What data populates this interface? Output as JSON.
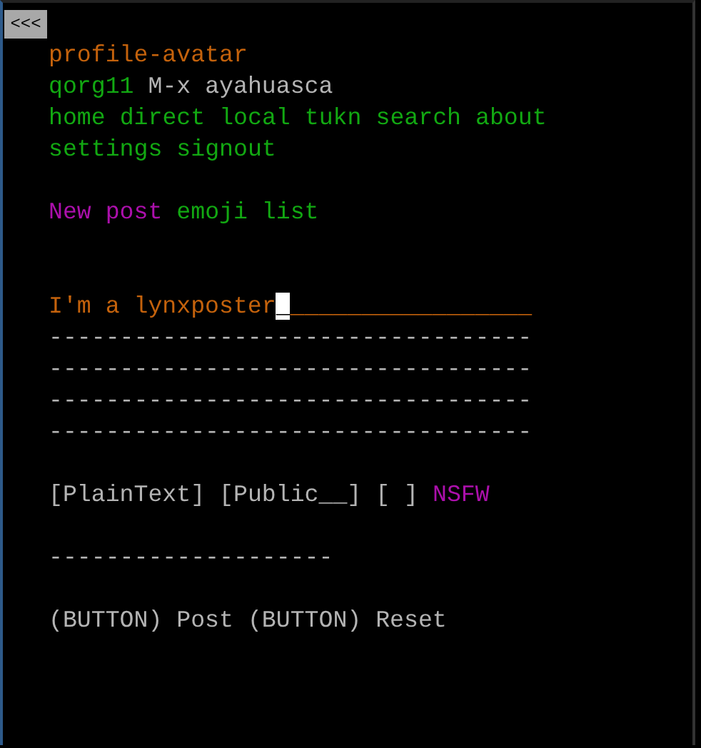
{
  "back_link": {
    "label": "<<<"
  },
  "header": [
    [
      {
        "kind": "alt",
        "text": "profile-avatar"
      }
    ],
    [
      {
        "kind": "link",
        "text": "qorg11"
      },
      {
        "kind": "text",
        "text": "M-x ayahuasca"
      }
    ],
    [
      {
        "kind": "link",
        "text": "home"
      },
      {
        "kind": "link",
        "text": "direct"
      },
      {
        "kind": "link",
        "text": "local"
      },
      {
        "kind": "link",
        "text": "tukn"
      },
      {
        "kind": "link",
        "text": "search"
      },
      {
        "kind": "link",
        "text": "about"
      }
    ],
    [
      {
        "kind": "link",
        "text": "settings"
      },
      {
        "kind": "link",
        "text": "signout"
      }
    ]
  ],
  "post_links": [
    {
      "kind": "label",
      "text": "New post"
    },
    {
      "kind": "link",
      "text": "emoji list"
    }
  ],
  "textarea": {
    "focused": true,
    "value": "I'm a lynxposter",
    "cursor": "_",
    "fill": "_________________",
    "lines": [
      "----------------------------------",
      "----------------------------------",
      "----------------------------------",
      "----------------------------------"
    ]
  },
  "options": [
    {
      "kind": "select",
      "text": "[PlainText]"
    },
    {
      "kind": "select",
      "text": "[Public__]"
    },
    {
      "kind": "checkbox",
      "text": "[ ]",
      "checked": false
    },
    {
      "kind": "label",
      "text": "NSFW"
    }
  ],
  "input": {
    "value": "--------------------"
  },
  "buttons": [
    {
      "kind": "button",
      "text": "(BUTTON) Post"
    },
    {
      "kind": "button",
      "text": "(BUTTON) Reset"
    }
  ]
}
